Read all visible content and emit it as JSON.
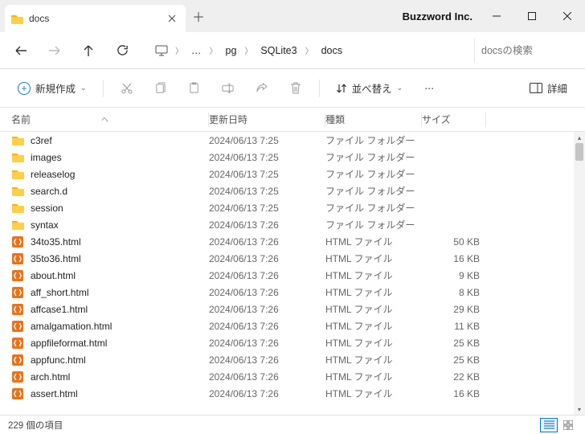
{
  "window": {
    "tab_title": "docs",
    "app_name": "Buzzword Inc."
  },
  "address": {
    "ellipsis": "…",
    "crumbs": [
      "pg",
      "SQLite3",
      "docs"
    ]
  },
  "search": {
    "placeholder": "docsの検索"
  },
  "toolbar": {
    "new_label": "新規作成",
    "sort_label": "並べ替え",
    "details_label": "詳細"
  },
  "columns": {
    "name": "名前",
    "date": "更新日時",
    "type": "種類",
    "size": "サイズ"
  },
  "files": [
    {
      "icon": "folder",
      "name": "c3ref",
      "date": "2024/06/13 7:25",
      "type": "ファイル フォルダー",
      "size": ""
    },
    {
      "icon": "folder",
      "name": "images",
      "date": "2024/06/13 7:25",
      "type": "ファイル フォルダー",
      "size": ""
    },
    {
      "icon": "folder",
      "name": "releaselog",
      "date": "2024/06/13 7:25",
      "type": "ファイル フォルダー",
      "size": ""
    },
    {
      "icon": "folder",
      "name": "search.d",
      "date": "2024/06/13 7:25",
      "type": "ファイル フォルダー",
      "size": ""
    },
    {
      "icon": "folder",
      "name": "session",
      "date": "2024/06/13 7:25",
      "type": "ファイル フォルダー",
      "size": ""
    },
    {
      "icon": "folder",
      "name": "syntax",
      "date": "2024/06/13 7:26",
      "type": "ファイル フォルダー",
      "size": ""
    },
    {
      "icon": "html",
      "name": "34to35.html",
      "date": "2024/06/13 7:26",
      "type": "HTML ファイル",
      "size": "50 KB"
    },
    {
      "icon": "html",
      "name": "35to36.html",
      "date": "2024/06/13 7:26",
      "type": "HTML ファイル",
      "size": "16 KB"
    },
    {
      "icon": "html",
      "name": "about.html",
      "date": "2024/06/13 7:26",
      "type": "HTML ファイル",
      "size": "9 KB"
    },
    {
      "icon": "html",
      "name": "aff_short.html",
      "date": "2024/06/13 7:26",
      "type": "HTML ファイル",
      "size": "8 KB"
    },
    {
      "icon": "html",
      "name": "affcase1.html",
      "date": "2024/06/13 7:26",
      "type": "HTML ファイル",
      "size": "29 KB"
    },
    {
      "icon": "html",
      "name": "amalgamation.html",
      "date": "2024/06/13 7:26",
      "type": "HTML ファイル",
      "size": "11 KB"
    },
    {
      "icon": "html",
      "name": "appfileformat.html",
      "date": "2024/06/13 7:26",
      "type": "HTML ファイル",
      "size": "25 KB"
    },
    {
      "icon": "html",
      "name": "appfunc.html",
      "date": "2024/06/13 7:26",
      "type": "HTML ファイル",
      "size": "25 KB"
    },
    {
      "icon": "html",
      "name": "arch.html",
      "date": "2024/06/13 7:26",
      "type": "HTML ファイル",
      "size": "22 KB"
    },
    {
      "icon": "html",
      "name": "assert.html",
      "date": "2024/06/13 7:26",
      "type": "HTML ファイル",
      "size": "16 KB"
    }
  ],
  "status": {
    "count": "229 個の項目"
  }
}
